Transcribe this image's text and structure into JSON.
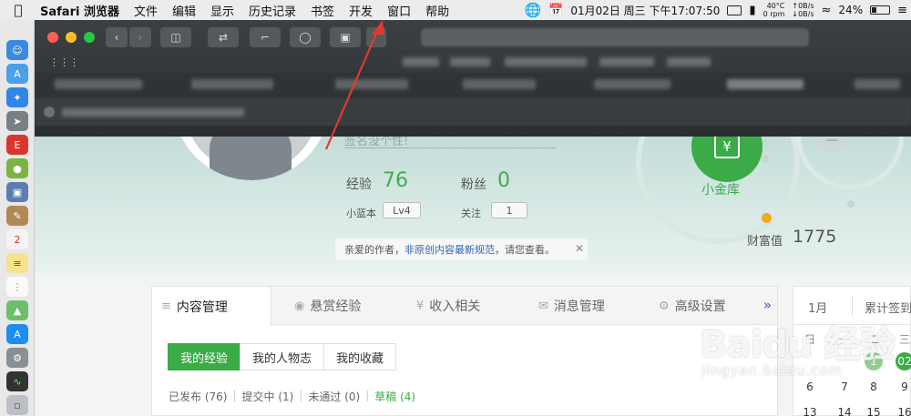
{
  "menubar": {
    "apple_icon": "apple-icon",
    "items": [
      "Safari 浏览器",
      "文件",
      "编辑",
      "显示",
      "历史记录",
      "书签",
      "开发",
      "窗口",
      "帮助"
    ],
    "clock": "01月02日 周三 下午17:07:50",
    "temp_line1": "40°C",
    "temp_line2": "0 rpm",
    "net_up": "0B/s",
    "net_down": "0B/s",
    "battery": "24%"
  },
  "profile": {
    "signature": "签名没个性!",
    "exp_label": "经验",
    "exp_value": "76",
    "fans_label": "粉丝",
    "fans_value": "0",
    "level_label": "小蓝本",
    "level_value": "Lv4",
    "follow_label": "关注",
    "follow_value": "1",
    "notice_prefix": "亲爱的作者，",
    "notice_link": "非原创内容最新规范",
    "notice_suffix": "，请您查看。",
    "notice_close": "✕",
    "vault_label": "小金库",
    "wealth_label": "财富值",
    "wealth_value": "1775"
  },
  "panel": {
    "tabs": [
      {
        "icon": "list-icon",
        "label": "内容管理"
      },
      {
        "icon": "reward-icon",
        "label": "悬赏经验"
      },
      {
        "icon": "yen-icon",
        "label": "收入相关"
      },
      {
        "icon": "mail-icon",
        "label": "消息管理"
      },
      {
        "icon": "gear-icon",
        "label": "高级设置"
      }
    ],
    "more": "»",
    "subtabs": [
      "我的经验",
      "我的人物志",
      "我的收藏"
    ],
    "filters": [
      "已发布 (76)",
      "提交中 (1)",
      "未通过 (0)",
      "草稿 (4)"
    ]
  },
  "calendar": {
    "month": "1月",
    "accum_label": "累计签到",
    "weekdays": [
      "日",
      "一",
      "二",
      "三"
    ],
    "rows": [
      [
        "",
        "",
        "1",
        "02"
      ],
      [
        "6",
        "7",
        "8",
        "9"
      ],
      [
        "13",
        "14",
        "15",
        "16"
      ]
    ]
  },
  "watermark": {
    "brand": "Baidu 经验",
    "url": "jingyan.baidu.com"
  },
  "colors": {
    "accent": "#3aab47",
    "link": "#2d64b3",
    "arrow": "#e03a2f"
  }
}
